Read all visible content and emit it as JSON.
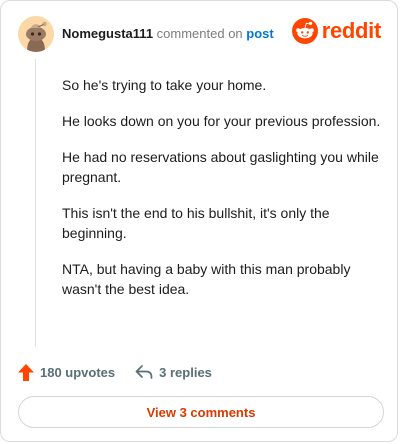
{
  "comment": {
    "username": "Nomegusta111",
    "commented_text": "commented on",
    "post_link": "post",
    "brand": "reddit",
    "paragraphs": [
      "So he's trying to take your home.",
      "He looks down on you for your previous profession.",
      "He had no reservations about gaslighting you while pregnant.",
      "This isn't the end to his bullshit, it's only the beginning.",
      "NTA, but having a baby with this man probably wasn't the best idea."
    ]
  },
  "actions": {
    "upvotes": "180 upvotes",
    "replies": "3 replies"
  },
  "view_button": "View 3 comments",
  "colors": {
    "brand": "#ff4500",
    "link": "#0079d3",
    "upvote": "#ff4500",
    "view_button_text": "#d93a00"
  },
  "icons": {
    "avatar": "snoo-avatar",
    "brand": "reddit-alien-icon",
    "upvote": "upvote-arrow-icon",
    "reply": "reply-arrow-icon"
  }
}
